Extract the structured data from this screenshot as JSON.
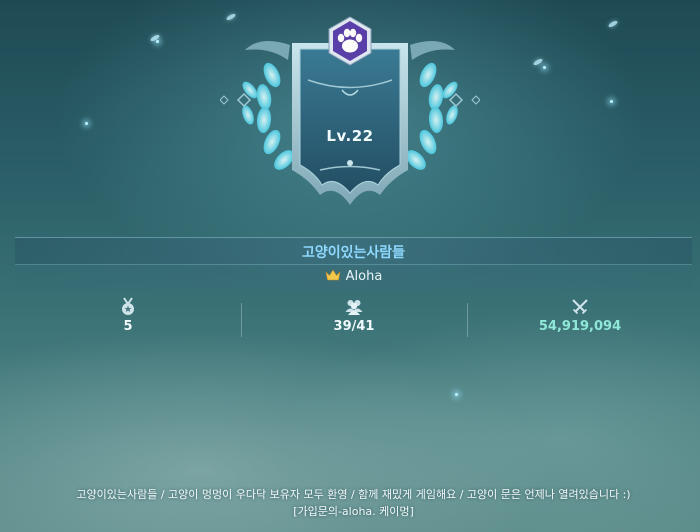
{
  "guild": {
    "level": "Lv.22",
    "name": "고양이있는사람들",
    "leader": "Aloha",
    "stats": {
      "rank": "5",
      "members": "39/41",
      "power": "54,919,094"
    },
    "intro_line1": "고양이있는사람들 / 고양이 멍멍이 우다닥 보유자 모두 환영 / 함께 재밌게 게임해요 / 고양이 문은 언제나 열려있습니다 :)",
    "intro_line2": "[가입문의-aloha. 케이멍]"
  },
  "icons": {
    "emblem": "paw-icon",
    "leader": "crown-icon",
    "rank": "medal-icon",
    "members": "people-icon",
    "power": "crossed-swords-icon"
  },
  "colors": {
    "guild_name": "#8fd8ff",
    "power_value": "#8fe8d8",
    "badge": "#5a3fa8"
  }
}
